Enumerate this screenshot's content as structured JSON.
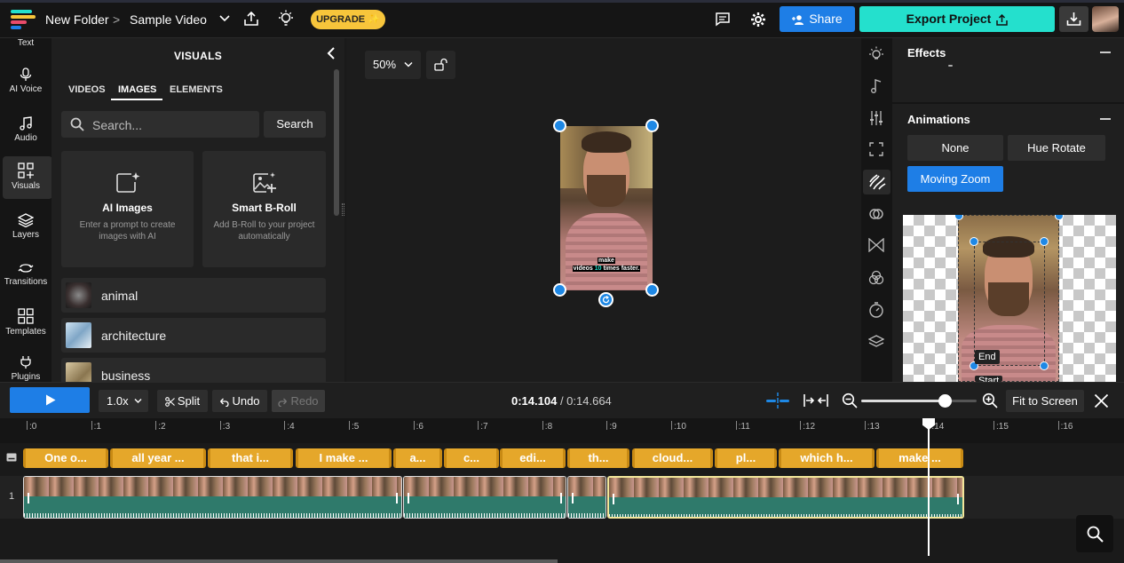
{
  "topbar": {
    "folder": "New Folder",
    "separator": ">",
    "project": "Sample Video",
    "upgrade_label": "UPGRADE ✨",
    "share_label": "Share",
    "export_label": "Export Project"
  },
  "rail": {
    "items": [
      {
        "label": "Text"
      },
      {
        "label": "AI Voice"
      },
      {
        "label": "Audio"
      },
      {
        "label": "Visuals"
      },
      {
        "label": "Layers"
      },
      {
        "label": "Transitions"
      },
      {
        "label": "Templates"
      },
      {
        "label": "Plugins"
      }
    ],
    "active": "Visuals"
  },
  "visuals": {
    "title": "VISUALS",
    "tabs": [
      "VIDEOS",
      "IMAGES",
      "ELEMENTS"
    ],
    "active_tab": "IMAGES",
    "search_placeholder": "Search...",
    "search_button": "Search",
    "cards": [
      {
        "title": "AI Images",
        "desc": "Enter a prompt to create images with AI"
      },
      {
        "title": "Smart B-Roll",
        "desc": "Add B-Roll to your project automatically"
      }
    ],
    "categories": [
      "animal",
      "architecture",
      "business"
    ]
  },
  "preview": {
    "zoom": "50%",
    "subtitle_line1": "make",
    "subtitle_line2a": "videos ",
    "subtitle_highlight": "10",
    "subtitle_line2b": " times faster."
  },
  "right_panel": {
    "effects_title": "Effects",
    "animations_title": "Animations",
    "animation_options": [
      "None",
      "Hue Rotate",
      "Moving Zoom"
    ],
    "selected_animation": "Moving Zoom",
    "end_label": "End",
    "start_label_partial": "Start"
  },
  "timeline": {
    "speed": "1.0x",
    "split_label": "Split",
    "undo_label": "Undo",
    "redo_label": "Redo",
    "current_time": "0:14.104",
    "time_separator": " / ",
    "total_time": "0:14.664",
    "fit_label": "Fit to Screen",
    "zoom_slider_value": 0.72,
    "ticks": [
      ":0",
      ":1",
      ":2",
      ":3",
      ":4",
      ":5",
      ":6",
      ":7",
      ":8",
      ":9",
      ":10",
      ":11",
      ":12",
      ":13",
      ":14",
      ":15",
      ":16"
    ],
    "track_number": "1",
    "captions": [
      "One o...",
      "all year ...",
      "that i...",
      "I make ...",
      "a...",
      "c...",
      "edi...",
      "th...",
      "cloud...",
      "pl...",
      "which h...",
      "make ..."
    ]
  },
  "colors": {
    "accent_blue": "#1e7ee6",
    "export_teal": "#24e0cd",
    "upgrade_yellow": "#f7c53b",
    "caption_orange": "#e5a72a",
    "handle_blue": "#1e88e5"
  }
}
